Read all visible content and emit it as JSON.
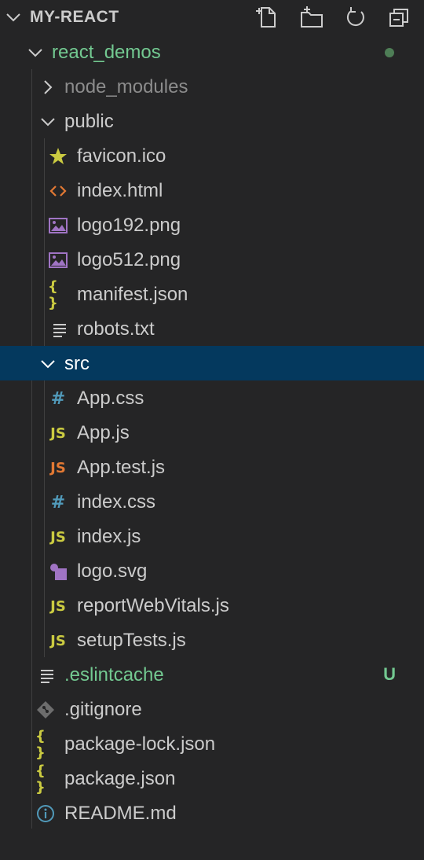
{
  "explorer": {
    "title": "MY-REACT",
    "actions": [
      "new-file-icon",
      "new-folder-icon",
      "refresh-icon",
      "collapse-all-icon"
    ]
  },
  "tree": {
    "root_folder": {
      "label": "react_demos"
    },
    "node_modules": {
      "label": "node_modules"
    },
    "public": {
      "label": "public",
      "files": {
        "favicon": "favicon.ico",
        "index_html": "index.html",
        "logo192": "logo192.png",
        "logo512": "logo512.png",
        "manifest": "manifest.json",
        "robots": "robots.txt"
      }
    },
    "src": {
      "label": "src",
      "files": {
        "app_css": "App.css",
        "app_js": "App.js",
        "app_test": "App.test.js",
        "index_css": "index.css",
        "index_js": "index.js",
        "logo_svg": "logo.svg",
        "report": "reportWebVitals.js",
        "setup": "setupTests.js"
      }
    },
    "root_files": {
      "eslintcache": "eslintcache_label",
      "gitignore": ".gitignore",
      "package_lock": "package-lock.json",
      "package": "package.json",
      "readme": "README.md"
    },
    "eslintcache_label": ".eslintcache",
    "eslintcache_status": "U",
    "icon_text": {
      "hash": "#",
      "js": "JS",
      "braces": "{ }"
    }
  },
  "colors": {
    "background": "#252526",
    "selected": "#04395e",
    "untracked": "#73c991",
    "css_icon": "#519aba",
    "js_icon": "#cbcb41",
    "test_icon": "#e37933",
    "image_icon": "#a074c4",
    "html_icon": "#e37933"
  }
}
